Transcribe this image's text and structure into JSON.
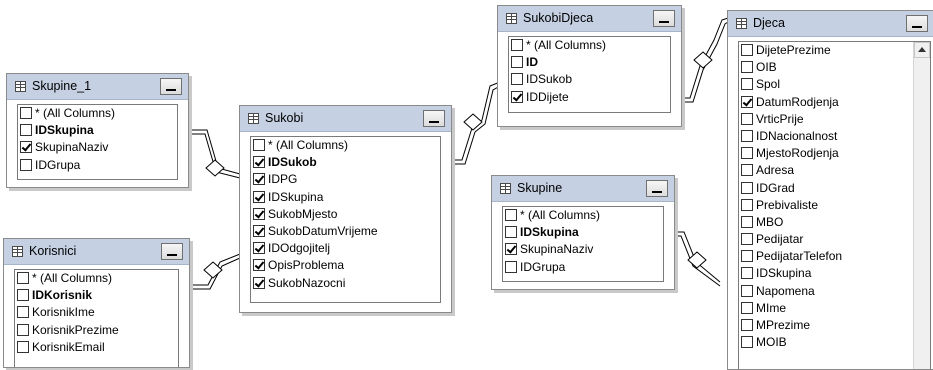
{
  "diagram": {
    "tables": [
      {
        "key": "skupine1",
        "title": "Skupine_1",
        "columns": [
          {
            "label": "* (All Columns)",
            "checked": false,
            "pk": false
          },
          {
            "label": "IDSkupina",
            "checked": false,
            "pk": true
          },
          {
            "label": "SkupinaNaziv",
            "checked": true,
            "pk": false
          },
          {
            "label": "IDGrupa",
            "checked": false,
            "pk": false
          }
        ]
      },
      {
        "key": "korisnici",
        "title": "Korisnici",
        "columns": [
          {
            "label": "* (All Columns)",
            "checked": false,
            "pk": false
          },
          {
            "label": "IDKorisnik",
            "checked": false,
            "pk": true
          },
          {
            "label": "KorisnikIme",
            "checked": false,
            "pk": false
          },
          {
            "label": "KorisnikPrezime",
            "checked": false,
            "pk": false
          },
          {
            "label": "KorisnikEmail",
            "checked": false,
            "pk": false
          }
        ]
      },
      {
        "key": "sukobi",
        "title": "Sukobi",
        "columns": [
          {
            "label": "* (All Columns)",
            "checked": false,
            "pk": false
          },
          {
            "label": "IDSukob",
            "checked": true,
            "pk": true
          },
          {
            "label": "IDPG",
            "checked": true,
            "pk": false
          },
          {
            "label": "IDSkupina",
            "checked": true,
            "pk": false
          },
          {
            "label": "SukobMjesto",
            "checked": true,
            "pk": false
          },
          {
            "label": "SukobDatumVrijeme",
            "checked": true,
            "pk": false
          },
          {
            "label": "IDOdgojitelj",
            "checked": true,
            "pk": false
          },
          {
            "label": "OpisProblema",
            "checked": true,
            "pk": false
          },
          {
            "label": "SukobNazocni",
            "checked": true,
            "pk": false
          }
        ]
      },
      {
        "key": "sukobidjeca",
        "title": "SukobiDjeca",
        "columns": [
          {
            "label": "* (All Columns)",
            "checked": false,
            "pk": false
          },
          {
            "label": "ID",
            "checked": false,
            "pk": true
          },
          {
            "label": "IDSukob",
            "checked": false,
            "pk": false
          },
          {
            "label": "IDDijete",
            "checked": true,
            "pk": false
          }
        ]
      },
      {
        "key": "skupine",
        "title": "Skupine",
        "columns": [
          {
            "label": "* (All Columns)",
            "checked": false,
            "pk": false
          },
          {
            "label": "IDSkupina",
            "checked": false,
            "pk": true
          },
          {
            "label": "SkupinaNaziv",
            "checked": true,
            "pk": false
          },
          {
            "label": "IDGrupa",
            "checked": false,
            "pk": false
          }
        ]
      },
      {
        "key": "djeca",
        "title": "Djeca",
        "columns": [
          {
            "label": "DijetePrezime",
            "checked": false,
            "pk": false
          },
          {
            "label": "OIB",
            "checked": false,
            "pk": false
          },
          {
            "label": "Spol",
            "checked": false,
            "pk": false
          },
          {
            "label": "DatumRodjenja",
            "checked": true,
            "pk": false
          },
          {
            "label": "VrticPrije",
            "checked": false,
            "pk": false
          },
          {
            "label": "IDNacionalnost",
            "checked": false,
            "pk": false
          },
          {
            "label": "MjestoRodjenja",
            "checked": false,
            "pk": false
          },
          {
            "label": "Adresa",
            "checked": false,
            "pk": false
          },
          {
            "label": "IDGrad",
            "checked": false,
            "pk": false
          },
          {
            "label": "Prebivaliste",
            "checked": false,
            "pk": false
          },
          {
            "label": "MBO",
            "checked": false,
            "pk": false
          },
          {
            "label": "Pedijatar",
            "checked": false,
            "pk": false
          },
          {
            "label": "PedijatarTelefon",
            "checked": false,
            "pk": false
          },
          {
            "label": "IDSkupina",
            "checked": false,
            "pk": false
          },
          {
            "label": "Napomena",
            "checked": false,
            "pk": false
          },
          {
            "label": "MIme",
            "checked": false,
            "pk": false
          },
          {
            "label": "MPrezime",
            "checked": false,
            "pk": false
          },
          {
            "label": "MOIB",
            "checked": false,
            "pk": false
          }
        ]
      }
    ]
  }
}
